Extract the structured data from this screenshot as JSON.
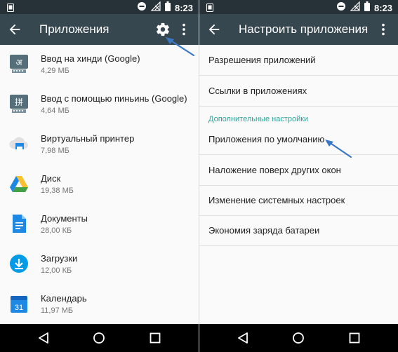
{
  "status_bar": {
    "time": "8:23"
  },
  "left_screen": {
    "title": "Приложения",
    "apps": [
      {
        "name": "Ввод на хинди (Google)",
        "size": "4,29 МБ",
        "icon": "hindi-keyboard-icon"
      },
      {
        "name": "Ввод с помощью пиньинь (Google)",
        "size": "4,64 МБ",
        "icon": "pinyin-keyboard-icon"
      },
      {
        "name": "Виртуальный принтер",
        "size": "7,98 МБ",
        "icon": "cloud-print-icon"
      },
      {
        "name": "Диск",
        "size": "19,38 МБ",
        "icon": "drive-icon"
      },
      {
        "name": "Документы",
        "size": "28,00 КБ",
        "icon": "docs-icon"
      },
      {
        "name": "Загрузки",
        "size": "12,00 КБ",
        "icon": "downloads-icon"
      },
      {
        "name": "Календарь",
        "size": "11,97 МБ",
        "icon": "calendar-icon"
      }
    ],
    "calendar_day": "31",
    "hindi_glyph": "अ",
    "pinyin_glyph": "拼"
  },
  "right_screen": {
    "title": "Настроить приложения",
    "items": [
      {
        "label": "Разрешения приложений"
      },
      {
        "label": "Ссылки в приложениях"
      }
    ],
    "section_header": "Дополнительные настройки",
    "advanced_items": [
      {
        "label": "Приложения по умолчанию"
      },
      {
        "label": "Наложение поверх других окон"
      },
      {
        "label": "Изменение системных настроек"
      },
      {
        "label": "Экономия заряда батареи"
      }
    ]
  },
  "colors": {
    "status_bar": "#263238",
    "toolbar": "#37474f",
    "accent": "#26a69a",
    "annotation_arrow": "#3b78c4"
  }
}
